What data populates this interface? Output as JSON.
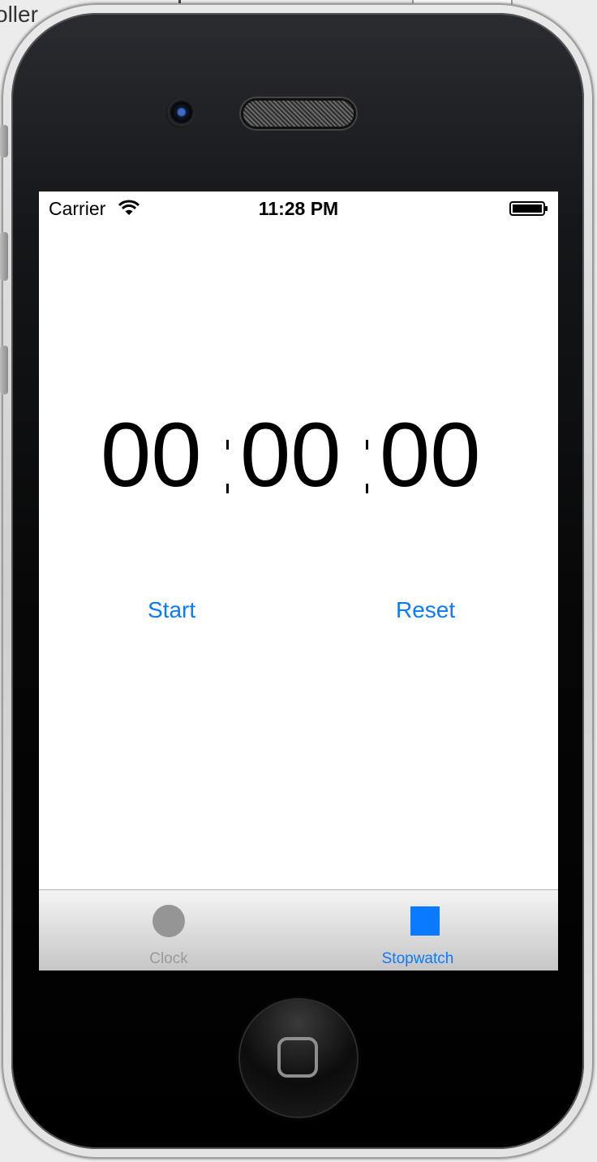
{
  "background": {
    "partial_text": "oller"
  },
  "status_bar": {
    "carrier": "Carrier",
    "time": "11:28 PM"
  },
  "stopwatch": {
    "minutes": "00",
    "seconds": "00",
    "hundredths": "00"
  },
  "controls": {
    "start_label": "Start",
    "reset_label": "Reset"
  },
  "tab_bar": {
    "tabs": [
      {
        "label": "Clock",
        "selected": false
      },
      {
        "label": "Stopwatch",
        "selected": true
      }
    ]
  },
  "colors": {
    "accent": "#0a7aff",
    "inactive_tab": "#959595"
  }
}
